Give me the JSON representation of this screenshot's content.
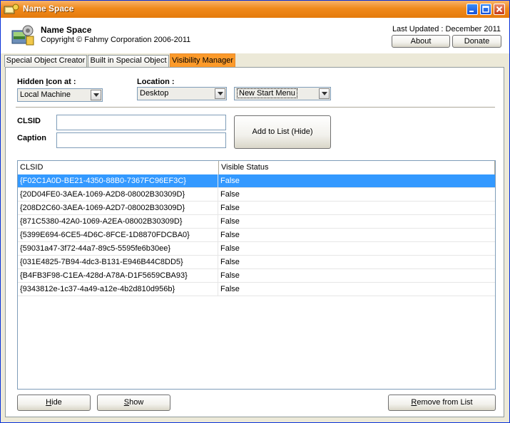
{
  "window": {
    "title": "Name Space"
  },
  "header": {
    "app_name": "Name Space",
    "copyright": "Copyright © Fahmy Corporation 2006-2011",
    "last_updated": "Last Updated : December 2011",
    "about_label": "About",
    "donate_label": "Donate"
  },
  "tabs": [
    {
      "label": "Special Object Creator"
    },
    {
      "label": "Built in Special Object"
    },
    {
      "label": "Visibility Manager"
    }
  ],
  "form": {
    "hidden_icon_label_pre": "Hidden ",
    "hidden_icon_label_u": "I",
    "hidden_icon_label_post": "con at :",
    "hidden_icon_value": "Local Machine",
    "location_label": "Location :",
    "location_value": "Desktop",
    "menu_value": "New Start Menu",
    "clsid_label": "CLSID",
    "caption_label": "Caption",
    "clsid_value": "",
    "caption_value": "",
    "add_button_label": "Add to List (Hide)"
  },
  "list": {
    "columns": [
      "CLSID",
      "Visible Status"
    ],
    "rows": [
      {
        "clsid": "{F02C1A0D-BE21-4350-88B0-7367FC96EF3C}",
        "status": "False"
      },
      {
        "clsid": "{20D04FE0-3AEA-1069-A2D8-08002B30309D}",
        "status": "False"
      },
      {
        "clsid": "{208D2C60-3AEA-1069-A2D7-08002B30309D}",
        "status": "False"
      },
      {
        "clsid": "{871C5380-42A0-1069-A2EA-08002B30309D}",
        "status": "False"
      },
      {
        "clsid": "{5399E694-6CE5-4D6C-8FCE-1D8870FDCBA0}",
        "status": "False"
      },
      {
        "clsid": "{59031a47-3f72-44a7-89c5-5595fe6b30ee}",
        "status": "False"
      },
      {
        "clsid": "{031E4825-7B94-4dc3-B131-E946B44C8DD5}",
        "status": "False"
      },
      {
        "clsid": "{B4FB3F98-C1EA-428d-A78A-D1F5659CBA93}",
        "status": "False"
      },
      {
        "clsid": "{9343812e-1c37-4a49-a12e-4b2d810d956b}",
        "status": "False"
      }
    ]
  },
  "footer": {
    "hide_label_u": "H",
    "hide_label_rest": "ide",
    "show_label_u": "S",
    "show_label_rest": "how",
    "remove_label_u": "R",
    "remove_label_rest": "emove from List"
  },
  "colors": {
    "title_orange": "#f08a1c",
    "active_tab": "#fc9a2a",
    "selection": "#3399ff"
  }
}
